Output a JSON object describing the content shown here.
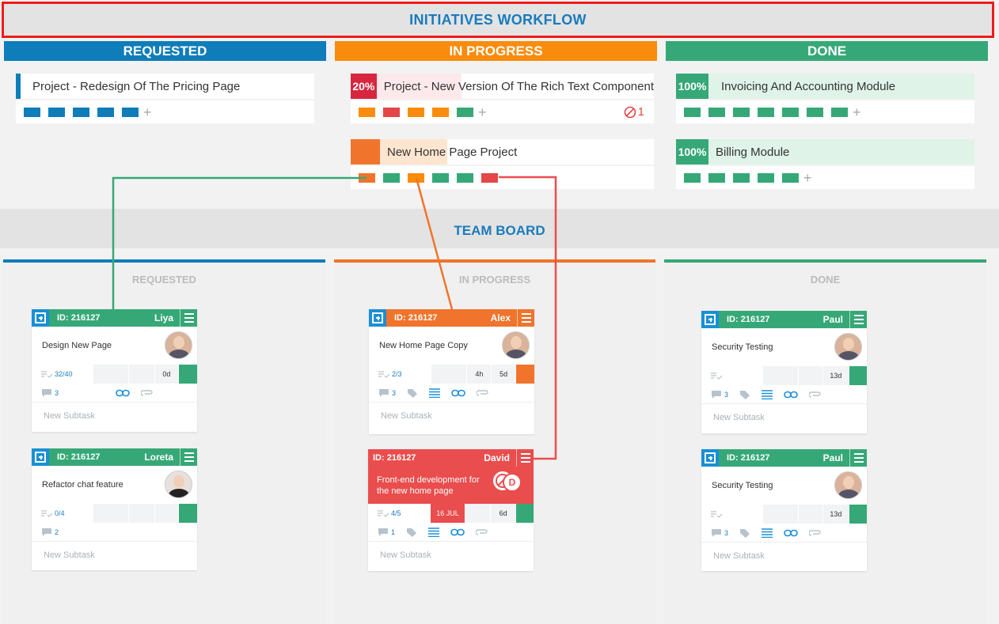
{
  "header": {
    "title": "INITIATIVES WORKFLOW"
  },
  "colors": {
    "blue": "#0e7dba",
    "orange": "#fa8c0d",
    "green": "#36a877",
    "red": "#e34747",
    "darkorange": "#f0742c",
    "crimson": "#d8263f"
  },
  "workflow_columns": [
    {
      "label": "REQUESTED",
      "color": "#0e7dba"
    },
    {
      "label": "IN PROGRESS",
      "color": "#fa8c0d"
    },
    {
      "label": "DONE",
      "color": "#36a877"
    }
  ],
  "initiatives": {
    "redesign": {
      "title": "Project - Redesign Of The Pricing Page"
    },
    "richtext": {
      "title": "Project - New Version Of The Rich Text Component",
      "percent": "20%",
      "blocked_count": "1"
    },
    "homepage": {
      "title": "New Home Page Project"
    },
    "invoicing": {
      "title": "Invoicing And Accounting Module",
      "percent": "100%"
    },
    "billing": {
      "title": "Billing Module",
      "percent": "100%"
    },
    "plus_label": "+"
  },
  "team_board": {
    "title": "TEAM BOARD",
    "columns": [
      "REQUESTED",
      "IN PROGRESS",
      "DONE"
    ]
  },
  "cards": {
    "liya": {
      "id": "ID: 216127",
      "name": "Liya",
      "title": "Design New Page",
      "checklist": "32/40",
      "days": "0d",
      "comments": "3",
      "subtask": "New Subtask"
    },
    "loreta": {
      "id": "ID: 216127",
      "name": "Loreta",
      "title": "Refactor chat feature",
      "checklist": "0/4",
      "comments": "2",
      "subtask": "New Subtask"
    },
    "alex": {
      "id": "ID: 216127",
      "name": "Alex",
      "title": "New Home Page Copy",
      "checklist": "2/3",
      "hours": "4h",
      "days": "5d",
      "comments": "3",
      "subtask": "New Subtask"
    },
    "david": {
      "id": "ID: 216127",
      "name": "David",
      "title": "Front-end development for the new home page",
      "checklist": "4/5",
      "date": "16 JUL",
      "days": "6d",
      "comments": "1",
      "badge": "D",
      "subtask": "New Subtask"
    },
    "paul1": {
      "id": "ID: 216127",
      "name": "Paul",
      "title": "Security Testing",
      "checklist": "",
      "days": "13d",
      "comments": "3",
      "subtask": "New Subtask"
    },
    "paul2": {
      "id": "ID: 216127",
      "name": "Paul",
      "title": "Security Testing",
      "checklist": "",
      "days": "13d",
      "comments": "3",
      "subtask": "New Subtask"
    }
  },
  "icons": {
    "add": "add-card-icon",
    "menu": "menu-icon",
    "checklist": "checklist-icon",
    "comment": "comment-icon",
    "tag": "tag-icon",
    "list": "list-icon",
    "link": "link-icon",
    "attach": "attachment-icon",
    "blocked": "blocked-icon"
  }
}
